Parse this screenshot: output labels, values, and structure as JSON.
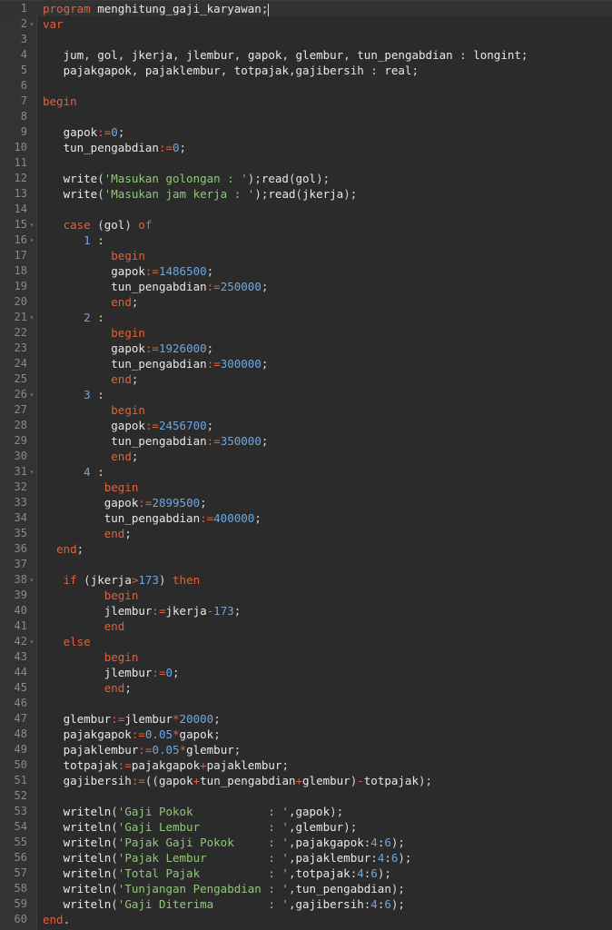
{
  "editor": {
    "colors": {
      "background": "#2b2b2b",
      "gutter": "#313335",
      "line_number": "#8a8a8a",
      "keyword": "#e0613a",
      "identifier": "#e8e8e8",
      "operator": "#e0613a",
      "number": "#6ea7e0",
      "string": "#8fc878"
    },
    "lines": [
      {
        "n": "1",
        "ind": 0,
        "tok": [
          [
            "kw",
            "program"
          ],
          [
            "id",
            " menghitung_gaji_karyawan"
          ],
          [
            "pun",
            ";"
          ]
        ],
        "caret": true
      },
      {
        "n": "2",
        "ind": 0,
        "fold": true,
        "tok": [
          [
            "kw",
            "var"
          ]
        ]
      },
      {
        "n": "3",
        "ind": 0,
        "tok": []
      },
      {
        "n": "4",
        "ind": 3,
        "tok": [
          [
            "id",
            "jum"
          ],
          [
            "pun",
            ", "
          ],
          [
            "id",
            "gol"
          ],
          [
            "pun",
            ", "
          ],
          [
            "id",
            "jkerja"
          ],
          [
            "pun",
            ", "
          ],
          [
            "id",
            "jlembur"
          ],
          [
            "pun",
            ", "
          ],
          [
            "id",
            "gapok"
          ],
          [
            "pun",
            ", "
          ],
          [
            "id",
            "glembur"
          ],
          [
            "pun",
            ", "
          ],
          [
            "id",
            "tun_pengabdian"
          ],
          [
            "pun",
            " : "
          ],
          [
            "id",
            "longint"
          ],
          [
            "pun",
            ";"
          ]
        ]
      },
      {
        "n": "5",
        "ind": 3,
        "tok": [
          [
            "id",
            "pajakgapok"
          ],
          [
            "pun",
            ", "
          ],
          [
            "id",
            "pajaklembur"
          ],
          [
            "pun",
            ", "
          ],
          [
            "id",
            "totpajak"
          ],
          [
            "pun",
            ","
          ],
          [
            "id",
            "gajibersih"
          ],
          [
            "pun",
            " : "
          ],
          [
            "id",
            "real"
          ],
          [
            "pun",
            ";"
          ]
        ]
      },
      {
        "n": "6",
        "ind": 0,
        "tok": []
      },
      {
        "n": "7",
        "ind": 0,
        "tok": [
          [
            "kw",
            "begin"
          ]
        ]
      },
      {
        "n": "8",
        "ind": 0,
        "tok": []
      },
      {
        "n": "9",
        "ind": 3,
        "tok": [
          [
            "id",
            "gapok"
          ],
          [
            "op",
            ":="
          ],
          [
            "num",
            "0"
          ],
          [
            "pun",
            ";"
          ]
        ]
      },
      {
        "n": "10",
        "ind": 3,
        "tok": [
          [
            "id",
            "tun_pengabdian"
          ],
          [
            "op",
            ":="
          ],
          [
            "num",
            "0"
          ],
          [
            "pun",
            ";"
          ]
        ]
      },
      {
        "n": "11",
        "ind": 0,
        "tok": []
      },
      {
        "n": "12",
        "ind": 3,
        "tok": [
          [
            "id",
            "write"
          ],
          [
            "pun",
            "("
          ],
          [
            "str",
            "'Masukan golongan : '"
          ],
          [
            "pun",
            ");"
          ],
          [
            "id",
            "read"
          ],
          [
            "pun",
            "("
          ],
          [
            "id",
            "gol"
          ],
          [
            "pun",
            ");"
          ]
        ]
      },
      {
        "n": "13",
        "ind": 3,
        "tok": [
          [
            "id",
            "write"
          ],
          [
            "pun",
            "("
          ],
          [
            "str",
            "'Masukan jam kerja : '"
          ],
          [
            "pun",
            ");"
          ],
          [
            "id",
            "read"
          ],
          [
            "pun",
            "("
          ],
          [
            "id",
            "jkerja"
          ],
          [
            "pun",
            ");"
          ]
        ]
      },
      {
        "n": "14",
        "ind": 0,
        "tok": []
      },
      {
        "n": "15",
        "ind": 3,
        "fold": true,
        "tok": [
          [
            "kw",
            "case"
          ],
          [
            "pun",
            " ("
          ],
          [
            "id",
            "gol"
          ],
          [
            "pun",
            ") "
          ],
          [
            "kw",
            "of"
          ]
        ]
      },
      {
        "n": "16",
        "ind": 6,
        "fold": true,
        "tok": [
          [
            "num",
            "1"
          ],
          [
            "pun",
            " :"
          ]
        ]
      },
      {
        "n": "17",
        "ind": 10,
        "tok": [
          [
            "kw",
            "begin"
          ]
        ]
      },
      {
        "n": "18",
        "ind": 10,
        "tok": [
          [
            "id",
            "gapok"
          ],
          [
            "op",
            ":="
          ],
          [
            "num",
            "1486500"
          ],
          [
            "pun",
            ";"
          ]
        ]
      },
      {
        "n": "19",
        "ind": 10,
        "tok": [
          [
            "id",
            "tun_pengabdian"
          ],
          [
            "op",
            ":="
          ],
          [
            "num",
            "250000"
          ],
          [
            "pun",
            ";"
          ]
        ]
      },
      {
        "n": "20",
        "ind": 10,
        "tok": [
          [
            "kw",
            "end"
          ],
          [
            "pun",
            ";"
          ]
        ]
      },
      {
        "n": "21",
        "ind": 6,
        "fold": true,
        "tok": [
          [
            "num",
            "2"
          ],
          [
            "pun",
            " :"
          ]
        ]
      },
      {
        "n": "22",
        "ind": 10,
        "tok": [
          [
            "kw",
            "begin"
          ]
        ]
      },
      {
        "n": "23",
        "ind": 10,
        "tok": [
          [
            "id",
            "gapok"
          ],
          [
            "op",
            ":="
          ],
          [
            "num",
            "1926000"
          ],
          [
            "pun",
            ";"
          ]
        ]
      },
      {
        "n": "24",
        "ind": 10,
        "tok": [
          [
            "id",
            "tun_pengabdian"
          ],
          [
            "op",
            ":="
          ],
          [
            "num",
            "300000"
          ],
          [
            "pun",
            ";"
          ]
        ]
      },
      {
        "n": "25",
        "ind": 10,
        "tok": [
          [
            "kw",
            "end"
          ],
          [
            "pun",
            ";"
          ]
        ]
      },
      {
        "n": "26",
        "ind": 6,
        "fold": true,
        "tok": [
          [
            "num",
            "3"
          ],
          [
            "pun",
            " :"
          ]
        ]
      },
      {
        "n": "27",
        "ind": 10,
        "tok": [
          [
            "kw",
            "begin"
          ]
        ]
      },
      {
        "n": "28",
        "ind": 10,
        "tok": [
          [
            "id",
            "gapok"
          ],
          [
            "op",
            ":="
          ],
          [
            "num",
            "2456700"
          ],
          [
            "pun",
            ";"
          ]
        ]
      },
      {
        "n": "29",
        "ind": 10,
        "tok": [
          [
            "id",
            "tun_pengabdian"
          ],
          [
            "op",
            ":="
          ],
          [
            "num",
            "350000"
          ],
          [
            "pun",
            ";"
          ]
        ]
      },
      {
        "n": "30",
        "ind": 10,
        "tok": [
          [
            "kw",
            "end"
          ],
          [
            "pun",
            ";"
          ]
        ]
      },
      {
        "n": "31",
        "ind": 6,
        "fold": true,
        "tok": [
          [
            "num",
            "4"
          ],
          [
            "pun",
            " :"
          ]
        ]
      },
      {
        "n": "32",
        "ind": 9,
        "tok": [
          [
            "kw",
            "begin"
          ]
        ]
      },
      {
        "n": "33",
        "ind": 9,
        "tok": [
          [
            "id",
            "gapok"
          ],
          [
            "op",
            ":="
          ],
          [
            "num",
            "2899500"
          ],
          [
            "pun",
            ";"
          ]
        ]
      },
      {
        "n": "34",
        "ind": 9,
        "tok": [
          [
            "id",
            "tun_pengabdian"
          ],
          [
            "op",
            ":="
          ],
          [
            "num",
            "400000"
          ],
          [
            "pun",
            ";"
          ]
        ]
      },
      {
        "n": "35",
        "ind": 9,
        "tok": [
          [
            "kw",
            "end"
          ],
          [
            "pun",
            ";"
          ]
        ]
      },
      {
        "n": "36",
        "ind": 2,
        "tok": [
          [
            "kw",
            "end"
          ],
          [
            "pun",
            ";"
          ]
        ]
      },
      {
        "n": "37",
        "ind": 0,
        "tok": []
      },
      {
        "n": "38",
        "ind": 3,
        "fold": true,
        "tok": [
          [
            "kw",
            "if"
          ],
          [
            "pun",
            " ("
          ],
          [
            "id",
            "jkerja"
          ],
          [
            "op",
            ">"
          ],
          [
            "num",
            "173"
          ],
          [
            "pun",
            ") "
          ],
          [
            "kw",
            "then"
          ]
        ]
      },
      {
        "n": "39",
        "ind": 9,
        "tok": [
          [
            "kw",
            "begin"
          ]
        ]
      },
      {
        "n": "40",
        "ind": 9,
        "tok": [
          [
            "id",
            "jlembur"
          ],
          [
            "op",
            ":="
          ],
          [
            "id",
            "jkerja"
          ],
          [
            "op",
            "-"
          ],
          [
            "num",
            "173"
          ],
          [
            "pun",
            ";"
          ]
        ]
      },
      {
        "n": "41",
        "ind": 9,
        "tok": [
          [
            "kw",
            "end"
          ]
        ]
      },
      {
        "n": "42",
        "ind": 3,
        "fold": true,
        "tok": [
          [
            "kw",
            "else"
          ]
        ]
      },
      {
        "n": "43",
        "ind": 9,
        "tok": [
          [
            "kw",
            "begin"
          ]
        ]
      },
      {
        "n": "44",
        "ind": 9,
        "tok": [
          [
            "id",
            "jlembur"
          ],
          [
            "op",
            ":="
          ],
          [
            "num",
            "0"
          ],
          [
            "pun",
            ";"
          ]
        ]
      },
      {
        "n": "45",
        "ind": 9,
        "tok": [
          [
            "kw",
            "end"
          ],
          [
            "pun",
            ";"
          ]
        ]
      },
      {
        "n": "46",
        "ind": 0,
        "tok": []
      },
      {
        "n": "47",
        "ind": 3,
        "tok": [
          [
            "id",
            "glembur"
          ],
          [
            "op",
            ":="
          ],
          [
            "id",
            "jlembur"
          ],
          [
            "op",
            "*"
          ],
          [
            "num",
            "20000"
          ],
          [
            "pun",
            ";"
          ]
        ]
      },
      {
        "n": "48",
        "ind": 3,
        "tok": [
          [
            "id",
            "pajakgapok"
          ],
          [
            "op",
            ":="
          ],
          [
            "num",
            "0.05"
          ],
          [
            "op",
            "*"
          ],
          [
            "id",
            "gapok"
          ],
          [
            "pun",
            ";"
          ]
        ]
      },
      {
        "n": "49",
        "ind": 3,
        "tok": [
          [
            "id",
            "pajaklembur"
          ],
          [
            "op",
            ":="
          ],
          [
            "num",
            "0.05"
          ],
          [
            "op",
            "*"
          ],
          [
            "id",
            "glembur"
          ],
          [
            "pun",
            ";"
          ]
        ]
      },
      {
        "n": "50",
        "ind": 3,
        "tok": [
          [
            "id",
            "totpajak"
          ],
          [
            "op",
            ":="
          ],
          [
            "id",
            "pajakgapok"
          ],
          [
            "op",
            "+"
          ],
          [
            "id",
            "pajaklembur"
          ],
          [
            "pun",
            ";"
          ]
        ]
      },
      {
        "n": "51",
        "ind": 3,
        "tok": [
          [
            "id",
            "gajibersih"
          ],
          [
            "op",
            ":="
          ],
          [
            "pun",
            "(("
          ],
          [
            "id",
            "gapok"
          ],
          [
            "op",
            "+"
          ],
          [
            "id",
            "tun_pengabdian"
          ],
          [
            "op",
            "+"
          ],
          [
            "id",
            "glembur"
          ],
          [
            "pun",
            ")"
          ],
          [
            "op",
            "-"
          ],
          [
            "id",
            "totpajak"
          ],
          [
            "pun",
            ");"
          ]
        ]
      },
      {
        "n": "52",
        "ind": 0,
        "tok": []
      },
      {
        "n": "53",
        "ind": 3,
        "tok": [
          [
            "id",
            "writeln"
          ],
          [
            "pun",
            "("
          ],
          [
            "str",
            "'Gaji Pokok           : '"
          ],
          [
            "pun",
            ","
          ],
          [
            "id",
            "gapok"
          ],
          [
            "pun",
            ");"
          ]
        ]
      },
      {
        "n": "54",
        "ind": 3,
        "tok": [
          [
            "id",
            "writeln"
          ],
          [
            "pun",
            "("
          ],
          [
            "str",
            "'Gaji Lembur          : '"
          ],
          [
            "pun",
            ","
          ],
          [
            "id",
            "glembur"
          ],
          [
            "pun",
            ");"
          ]
        ]
      },
      {
        "n": "55",
        "ind": 3,
        "tok": [
          [
            "id",
            "writeln"
          ],
          [
            "pun",
            "("
          ],
          [
            "str",
            "'Pajak Gaji Pokok     : '"
          ],
          [
            "pun",
            ","
          ],
          [
            "id",
            "pajakgapok"
          ],
          [
            "pun",
            ":"
          ],
          [
            "num",
            "4"
          ],
          [
            "pun",
            ":"
          ],
          [
            "num",
            "6"
          ],
          [
            "pun",
            ");"
          ]
        ]
      },
      {
        "n": "56",
        "ind": 3,
        "tok": [
          [
            "id",
            "writeln"
          ],
          [
            "pun",
            "("
          ],
          [
            "str",
            "'Pajak Lembur         : '"
          ],
          [
            "pun",
            ","
          ],
          [
            "id",
            "pajaklembur"
          ],
          [
            "pun",
            ":"
          ],
          [
            "num",
            "4"
          ],
          [
            "pun",
            ":"
          ],
          [
            "num",
            "6"
          ],
          [
            "pun",
            ");"
          ]
        ]
      },
      {
        "n": "57",
        "ind": 3,
        "tok": [
          [
            "id",
            "writeln"
          ],
          [
            "pun",
            "("
          ],
          [
            "str",
            "'Total Pajak          : '"
          ],
          [
            "pun",
            ","
          ],
          [
            "id",
            "totpajak"
          ],
          [
            "pun",
            ":"
          ],
          [
            "num",
            "4"
          ],
          [
            "pun",
            ":"
          ],
          [
            "num",
            "6"
          ],
          [
            "pun",
            ");"
          ]
        ]
      },
      {
        "n": "58",
        "ind": 3,
        "tok": [
          [
            "id",
            "writeln"
          ],
          [
            "pun",
            "("
          ],
          [
            "str",
            "'Tunjangan Pengabdian : '"
          ],
          [
            "pun",
            ","
          ],
          [
            "id",
            "tun_pengabdian"
          ],
          [
            "pun",
            ");"
          ]
        ]
      },
      {
        "n": "59",
        "ind": 3,
        "tok": [
          [
            "id",
            "writeln"
          ],
          [
            "pun",
            "("
          ],
          [
            "str",
            "'Gaji Diterima        : '"
          ],
          [
            "pun",
            ","
          ],
          [
            "id",
            "gajibersih"
          ],
          [
            "pun",
            ":"
          ],
          [
            "num",
            "4"
          ],
          [
            "pun",
            ":"
          ],
          [
            "num",
            "6"
          ],
          [
            "pun",
            ");"
          ]
        ]
      },
      {
        "n": "60",
        "ind": 0,
        "tok": [
          [
            "kw",
            "end"
          ],
          [
            "pun",
            "."
          ]
        ]
      }
    ]
  }
}
